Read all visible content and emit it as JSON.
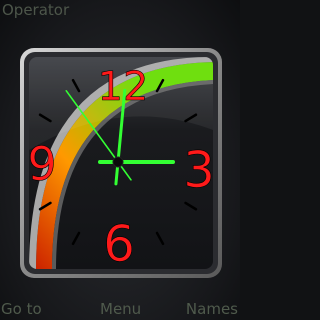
{
  "status_bar": {
    "operator": "Operator"
  },
  "clock": {
    "dial_numerals": [
      "12",
      "3",
      "6",
      "9"
    ],
    "time": {
      "hour": 3,
      "minute": 0,
      "second": 54
    },
    "colors": {
      "numerals": "#ff1a1a",
      "hands": "#33ff33",
      "ticks": "#000000",
      "arc_start": "#cc2200",
      "arc_mid": "#ff9900",
      "arc_end": "#66dd00"
    }
  },
  "softkeys": {
    "left": "Go to",
    "middle": "Menu",
    "right": "Names"
  }
}
